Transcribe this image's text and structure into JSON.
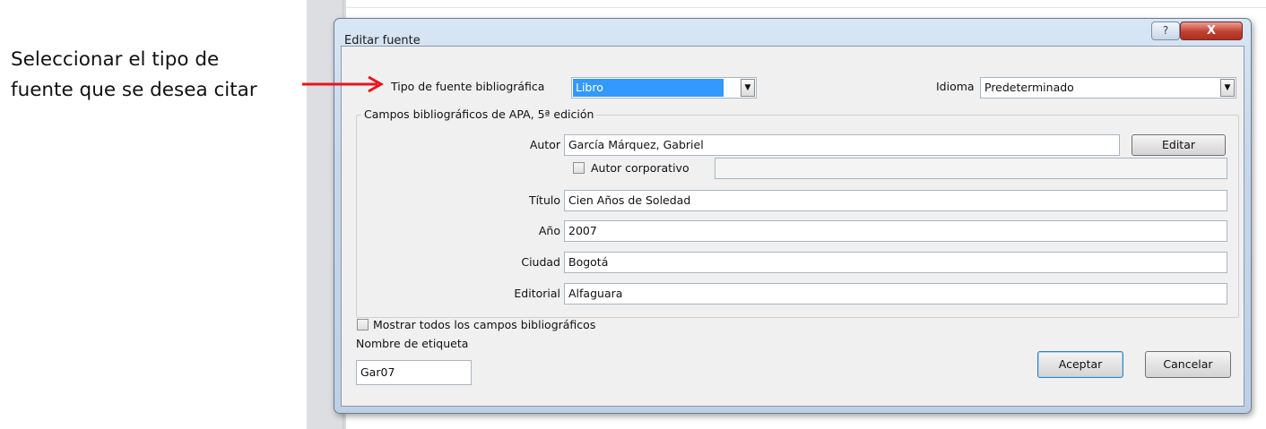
{
  "caption": {
    "line1": "Seleccionar el tipo de",
    "line2": "fuente que se desea citar"
  },
  "dialog": {
    "title": "Editar fuente",
    "help_glyph": "?",
    "close_glyph": "X",
    "source_type": {
      "label": "Tipo de fuente bibliográfica",
      "value": "Libro"
    },
    "language": {
      "label": "Idioma",
      "value": "Predeterminado"
    },
    "group_title": "Campos bibliográficos de APA, 5ª edición",
    "author": {
      "label": "Autor",
      "value": "García Márquez, Gabriel",
      "edit_button": "Editar"
    },
    "corporate_author": {
      "label": "Autor corporativo",
      "checked": false,
      "value": ""
    },
    "fields": [
      {
        "label": "Título",
        "value": "Cien Años de Soledad"
      },
      {
        "label": "Año",
        "value": "2007"
      },
      {
        "label": "Ciudad",
        "value": "Bogotá"
      },
      {
        "label": "Editorial",
        "value": "Alfaguara"
      }
    ],
    "show_all": {
      "label": "Mostrar todos los campos bibliográficos",
      "checked": false
    },
    "tag_name": {
      "label": "Nombre de etiqueta",
      "value": "Gar07"
    },
    "buttons": {
      "ok": "Aceptar",
      "cancel": "Cancelar"
    }
  },
  "colors": {
    "arrow": "#e8141e",
    "selection": "#3399ff",
    "dialog_frame": "#c7d8ec",
    "close_button": "#c2402f"
  }
}
